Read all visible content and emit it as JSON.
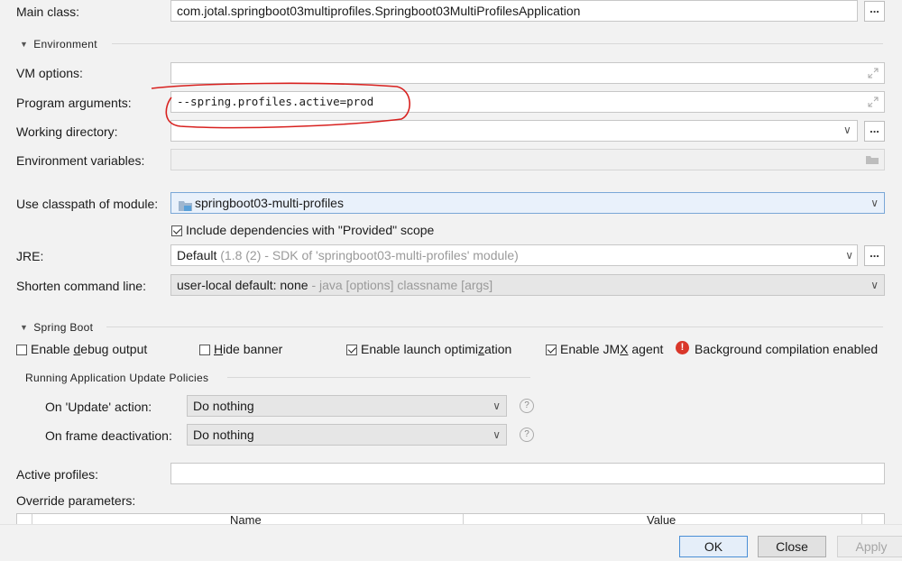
{
  "main_class": {
    "label": "Main class:",
    "value": "com.jotal.springboot03multiprofiles.Springboot03MultiProfilesApplication",
    "browse": "..."
  },
  "environment": {
    "title": "Environment",
    "vm_options_label": "VM options:",
    "vm_options_value": "",
    "program_args_label": "Program arguments:",
    "program_args_value": "--spring.profiles.active=prod",
    "working_dir_label": "Working directory:",
    "working_dir_value": "",
    "working_dir_browse": "...",
    "env_vars_label": "Environment variables:",
    "env_vars_value": ""
  },
  "classpath": {
    "label": "Use classpath of module:",
    "module": "springboot03-multi-profiles",
    "include_provided_label": "Include dependencies with \"Provided\" scope",
    "include_provided_checked": true
  },
  "jre": {
    "label": "JRE:",
    "value_main": "Default",
    "value_detail": "(1.8 (2) - SDK of 'springboot03-multi-profiles' module)",
    "browse": "..."
  },
  "shorten": {
    "label": "Shorten command line:",
    "value_main": "user-local default: none",
    "value_detail": "- java [options] classname [args]"
  },
  "spring_boot": {
    "title": "Spring Boot",
    "debug_output": {
      "pre": "Enable ",
      "mnemonic": "d",
      "post": "ebug output",
      "checked": false
    },
    "hide_banner": {
      "pre": "",
      "mnemonic": "H",
      "post": "ide banner",
      "checked": false
    },
    "launch_opt": {
      "pre": "Enable launch optimi",
      "mnemonic": "z",
      "post": "ation",
      "checked": true
    },
    "jmx": {
      "pre": "Enable JM",
      "mnemonic": "X",
      "post": " agent",
      "checked": true
    },
    "bg_compilation": "Background compilation enabled",
    "policies_title": "Running Application Update Policies",
    "on_update_label": "On 'Update' action:",
    "on_update_value": "Do nothing",
    "on_frame_label": "On frame deactivation:",
    "on_frame_value": "Do nothing",
    "help": "?"
  },
  "profiles": {
    "active_label": "Active profiles:",
    "active_value": "",
    "override_label": "Override parameters:",
    "columns": [
      "Name",
      "Value"
    ]
  },
  "buttons": {
    "ok": "OK",
    "close": "Close",
    "apply": "Apply"
  },
  "colors": {
    "annotation": "#d8211f",
    "error_badge": "#d9372a"
  }
}
